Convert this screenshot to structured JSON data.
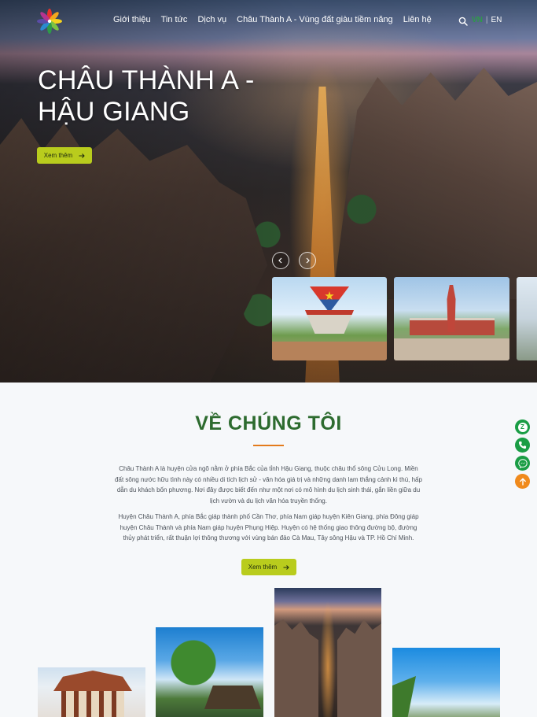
{
  "header": {
    "nav": [
      {
        "label": "Giới thiệu"
      },
      {
        "label": "Tin tức"
      },
      {
        "label": "Dịch vụ"
      },
      {
        "label": "Châu Thành A - Vùng đất giàu tiềm năng"
      },
      {
        "label": "Liên hệ"
      }
    ],
    "lang_active": "VN",
    "lang_sep": "|",
    "lang_other": "EN",
    "search_icon": "search-icon",
    "logo_icon": "pinwheel-logo"
  },
  "hero": {
    "title_line1": "CHÂU THÀNH A -",
    "title_line2": "HẬU GIANG",
    "button_label": "Xem thêm",
    "prev_icon": "chevron-left-icon",
    "next_icon": "chevron-right-icon"
  },
  "about": {
    "title": "VỀ CHÚNG TÔI",
    "paragraph1": "Châu Thành A là huyện cửa ngõ nằm ở phía Bắc của tỉnh Hậu Giang, thuộc châu thổ sông Cửu Long. Miền đất sông nước hữu tình này có nhiều di tích lịch sử - văn hóa giá trị và những danh lam thắng cảnh kì thú, hấp dẫn du khách bốn phương. Nơi đây được biết đến như một nơi có mô hình du lịch sinh thái, gắn liền giữa du lịch vườn và du lịch văn hóa truyền thống.",
    "paragraph2": "Huyện Châu Thành A, phía Bắc giáp thành phố Cần Thơ, phía Nam giáp huyện Kiên Giang, phía Đông giáp huyện Châu Thành và phía Nam giáp huyện Phụng Hiệp. Huyện có hệ thống giao thông đường bộ, đường thủy phát triển, rất thuận lợi thông thương với vùng bán đảo Cà Mau, Tây sông Hậu và TP. Hồ Chí Minh.",
    "button_label": "Xem thêm"
  },
  "floating": {
    "zalo_label": "Z",
    "icons": [
      "zalo-icon",
      "phone-icon",
      "messenger-icon",
      "arrow-up-icon"
    ]
  },
  "colors": {
    "accent_green": "#2d6b2f",
    "button_lime": "#b9cc1d",
    "rule_orange": "#e37b1c",
    "float_green": "#1a9d45",
    "float_orange": "#f08a1c"
  }
}
